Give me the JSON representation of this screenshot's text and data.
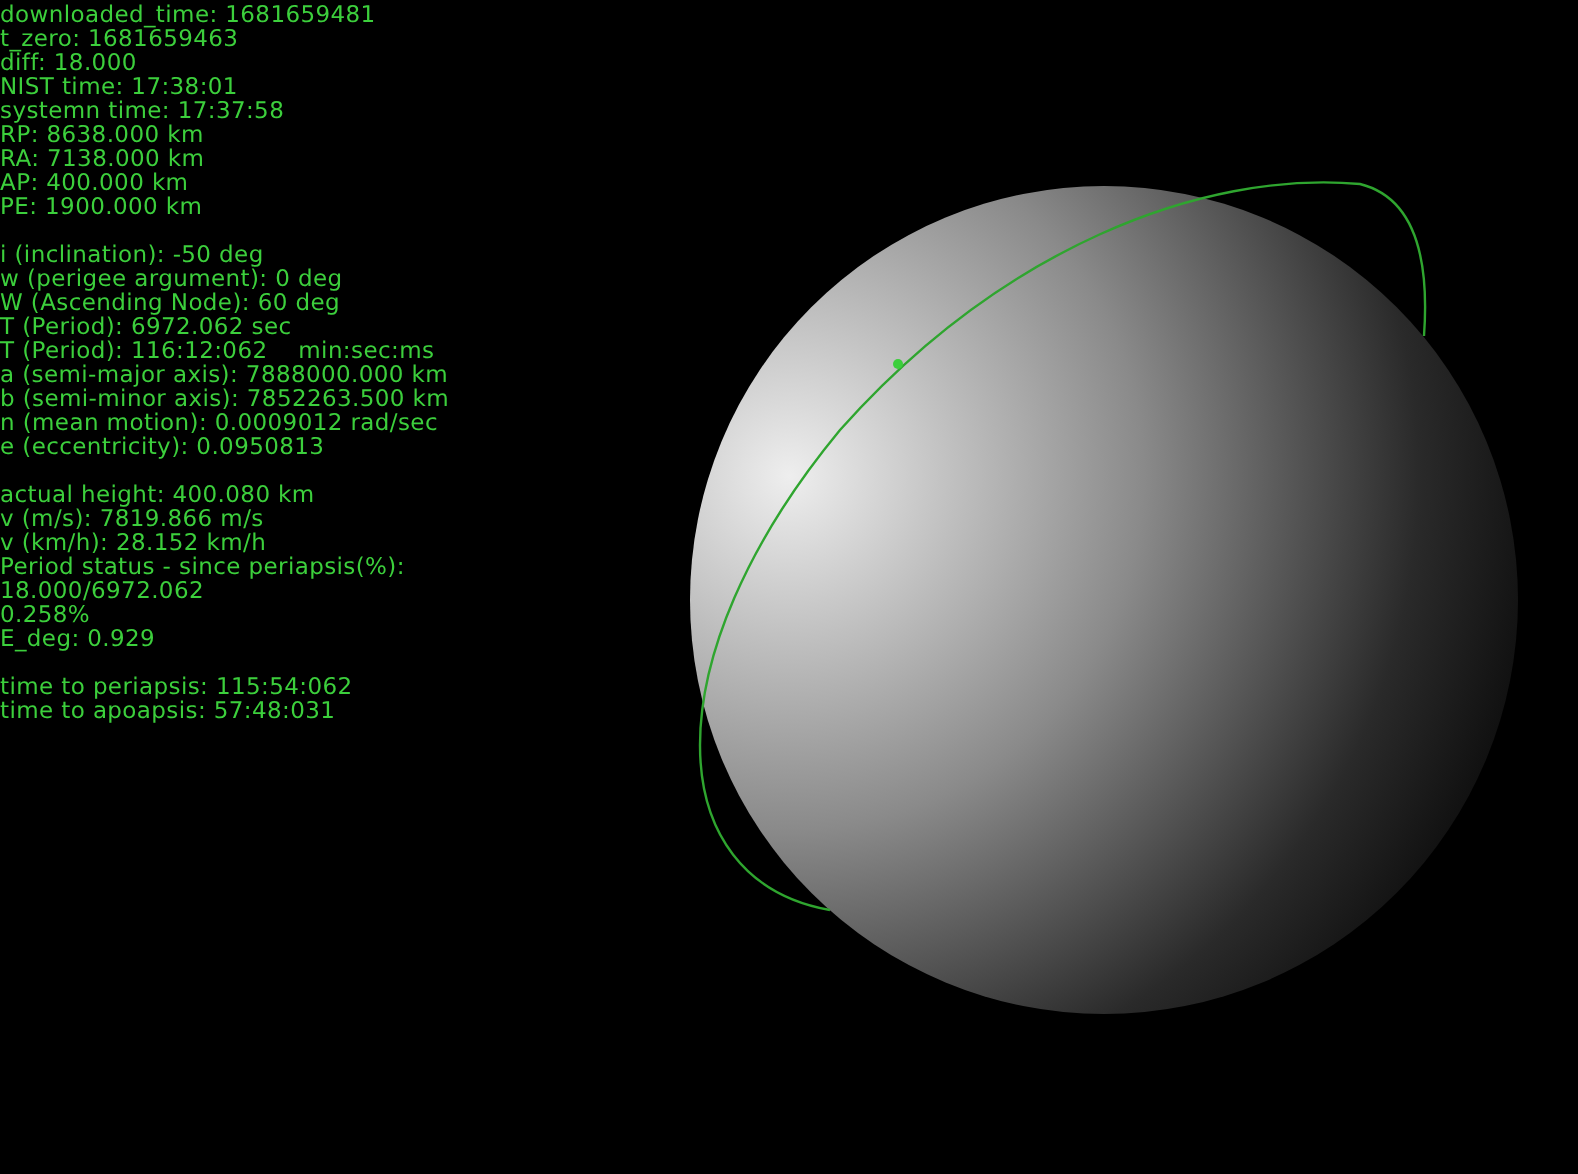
{
  "telemetry_groups": [
    [
      "downloaded_time: 1681659481",
      "t_zero: 1681659463",
      "diff: 18.000",
      "NIST time: 17:38:01",
      "systemn time: 17:37:58",
      "RP: 8638.000 km",
      "RA: 7138.000 km",
      "AP: 400.000 km",
      "PE: 1900.000 km"
    ],
    [
      "i (inclination): -50 deg",
      "w (perigee argument): 0 deg",
      "W (Ascending Node): 60 deg",
      "T (Period): 6972.062 sec",
      "T (Period): 116:12:062    min:sec:ms",
      "a (semi-major axis): 7888000.000 km",
      "b (semi-minor axis): 7852263.500 km",
      "n (mean motion): 0.0009012 rad/sec",
      "e (eccentricity): 0.0950813"
    ],
    [
      "actual height: 400.080 km",
      "v (m/s): 7819.866 m/s",
      "v (km/h): 28.152 km/h",
      "Period status - since periapsis(%):",
      "18.000/6972.062",
      "0.258%",
      "E_deg: 0.929"
    ],
    [
      "time to periapsis: 115:54:062",
      "time to apoapsis: 57:48:031"
    ]
  ]
}
